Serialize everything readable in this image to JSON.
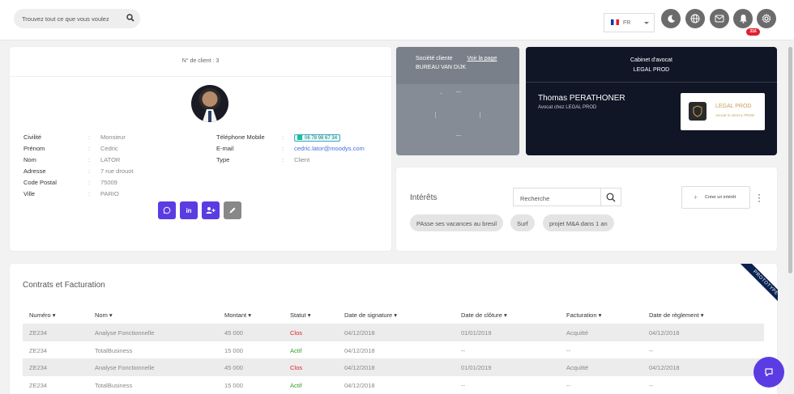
{
  "search": {
    "placeholder": "Trouvez tout ce que vous voulez"
  },
  "lang": {
    "code": "FR"
  },
  "notifications": {
    "count": "316"
  },
  "client": {
    "header": "N° de client : 3",
    "left": [
      {
        "label": "Civilité",
        "value": "Monsieur"
      },
      {
        "label": "Prénom",
        "value": "Cedric"
      },
      {
        "label": "Nom",
        "value": "LATOR"
      },
      {
        "label": "Adresse",
        "value": "7 rue drouot"
      },
      {
        "label": "Code Postal",
        "value": "75009"
      },
      {
        "label": "Ville",
        "value": "PARIO"
      }
    ],
    "right": [
      {
        "label": "Téléphone Mobile",
        "value": "06 78 98 67 34"
      },
      {
        "label": "E-mail",
        "value": "cedric.lator@moodys.com"
      },
      {
        "label": "Type",
        "value": "Client"
      }
    ],
    "actions": {
      "linkedin": "in"
    }
  },
  "societe": {
    "label": "Société cliente",
    "link": "Voir la page",
    "name": "BUREAU VAN DIJK"
  },
  "cabinet": {
    "label": "Cabinet d'avocat",
    "name": "LEGAL PROD",
    "lawyer": "Thomas PERATHONER",
    "role": "Avocat chez LEGAL PROD",
    "logo_text": "LEGAL PROD",
    "logo_sub": "Avocat in LEGAL PROD"
  },
  "interets": {
    "title": "Intérêts",
    "search_placeholder": "Recherche",
    "create": "Créer un intérêt",
    "tags": [
      "PAsse ses vacances au bresil",
      "Surf",
      "projet M&A dans 1 an"
    ]
  },
  "contrats": {
    "title": "Contrats et Facturation",
    "ribbon": "PROTOTYPE",
    "headers": [
      "Numéro",
      "Nom",
      "Montant",
      "Statut",
      "Date de signature",
      "Date de clôture",
      "Facturation",
      "Date de règlement"
    ],
    "rows": [
      [
        "ZE234",
        "Analyse Fonctionnelle",
        "45 000",
        "Clos",
        "04/12/2018",
        "01/01/2019",
        "Acquitté",
        "04/12/2018"
      ],
      [
        "ZE234",
        "TotalBusiness",
        "15 000",
        "Actif",
        "04/12/2018",
        "--",
        "--",
        "--"
      ],
      [
        "ZE234",
        "Analyse Fonctionnelle",
        "45 000",
        "Clos",
        "04/12/2018",
        "01/01/2019",
        "Acquitté",
        "04/12/2018"
      ],
      [
        "ZE234",
        "TotalBusiness",
        "15 000",
        "Actif",
        "04/12/2018",
        "--",
        "--",
        "--"
      ]
    ]
  },
  "colors": {
    "accent": "#5b3ce2",
    "clos": "#e0202e",
    "actif": "#3aa02a",
    "link": "#4a6fd8"
  },
  "icons": [
    "search-icon",
    "moon-icon",
    "globe-icon",
    "mail-icon",
    "bell-icon",
    "gear-icon",
    "whatsapp-icon",
    "linkedin-icon",
    "add-user-icon",
    "edit-icon",
    "more-icon",
    "plus-icon",
    "chat-icon"
  ]
}
